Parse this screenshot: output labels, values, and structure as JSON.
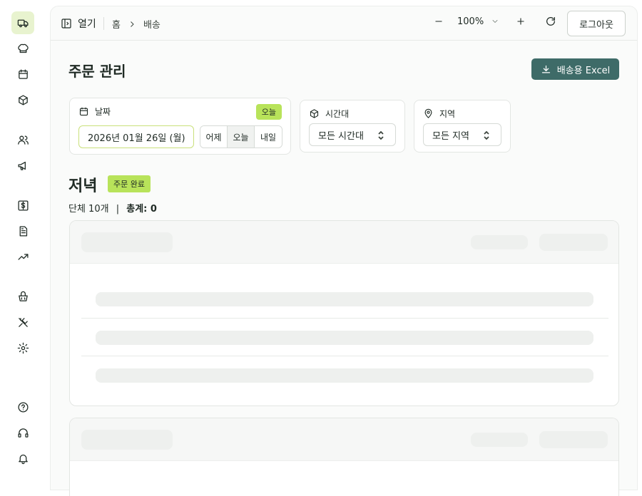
{
  "sidebar": {
    "icons": [
      "delivery-truck-icon",
      "chef-hat-icon",
      "calendar-icon",
      "package-icon",
      "users-icon",
      "megaphone-icon",
      "dollar-icon",
      "document-icon",
      "trending-icon",
      "basket-icon",
      "utensils-icon",
      "settings-icon",
      "help-icon",
      "headset-icon",
      "bell-icon"
    ],
    "active": "delivery-truck-icon"
  },
  "topbar": {
    "open_label": "열기",
    "breadcrumb": [
      "홈",
      "배송"
    ],
    "zoom_value": "100%",
    "logout_label": "로그아웃"
  },
  "page": {
    "title": "주문 관리",
    "excel_label": "배송용 Excel"
  },
  "filters": {
    "date_label": "날짜",
    "today_badge": "오늘",
    "date_value": "2026년 01월 26일 (월)",
    "quick": [
      "어제",
      "오늘",
      "내일"
    ],
    "quick_selected": "오늘",
    "time_label": "시간대",
    "time_value": "모든 시간대",
    "region_label": "지역",
    "region_value": "모든 지역"
  },
  "section": {
    "title": "저녁",
    "badge": "주문 완료",
    "count_text": "단체 10개",
    "separator": "|",
    "total_label": "총계: 0"
  },
  "colors": {
    "accent": "#b8e35a",
    "primary_button": "#3e6b68",
    "active_nav": "#e8f3cf"
  }
}
